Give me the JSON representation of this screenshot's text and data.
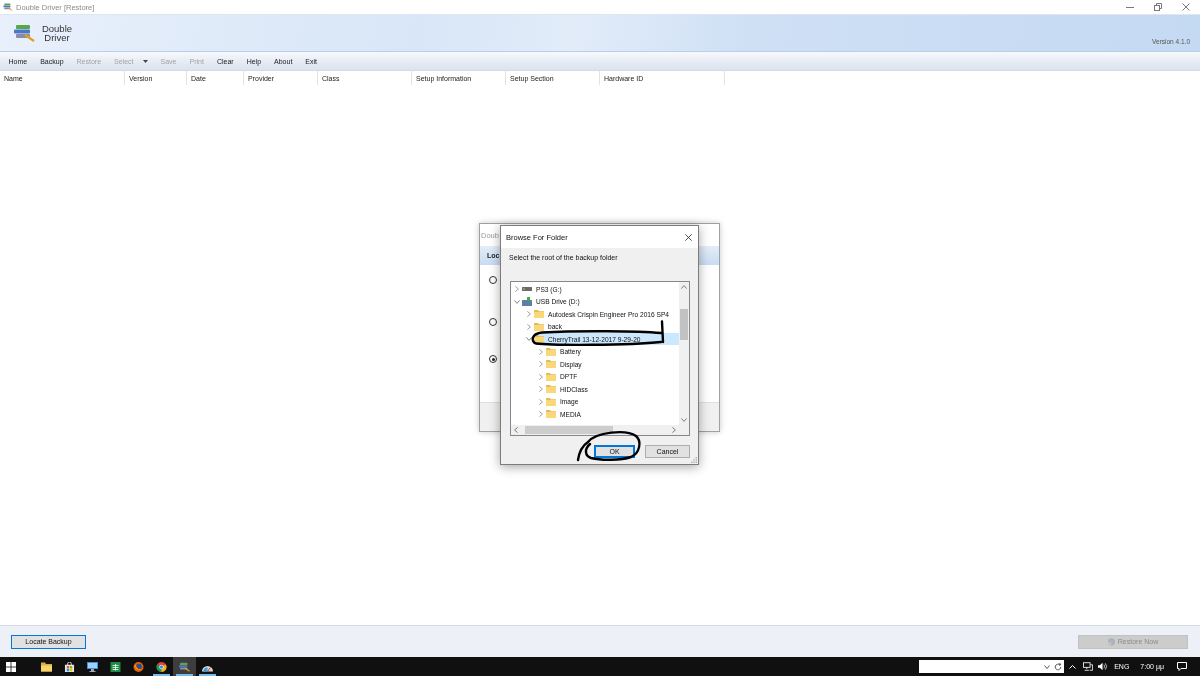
{
  "window": {
    "title": "Double Driver [Restore]"
  },
  "header": {
    "app_name": "Double Driver",
    "version": "Version 4.1.0"
  },
  "toolbar": [
    {
      "label": "Home",
      "disabled": false,
      "menu": false
    },
    {
      "label": "Backup",
      "disabled": false,
      "menu": false
    },
    {
      "label": "Restore",
      "disabled": true,
      "menu": false
    },
    {
      "label": "Select",
      "disabled": true,
      "menu": true
    },
    {
      "label": "Save",
      "disabled": true,
      "menu": false
    },
    {
      "label": "Print",
      "disabled": true,
      "menu": false
    },
    {
      "label": "Clear",
      "disabled": false,
      "menu": false
    },
    {
      "label": "Help",
      "disabled": false,
      "menu": false
    },
    {
      "label": "About",
      "disabled": false,
      "menu": false
    },
    {
      "label": "Exit",
      "disabled": false,
      "menu": false
    }
  ],
  "table": {
    "columns": [
      "Name",
      "Version",
      "Date",
      "Provider",
      "Class",
      "Setup Information",
      "Setup Section",
      "Hardware ID"
    ]
  },
  "back_dialog": {
    "title": "Doub",
    "heading": "Loc",
    "options": [
      {
        "selected": false
      },
      {
        "selected": false
      },
      {
        "selected": true
      }
    ]
  },
  "browse_dialog": {
    "title": "Browse For Folder",
    "prompt": "Select the root of the backup folder",
    "tree": [
      {
        "label": "PS3 (G:)",
        "kind": "drive",
        "expanded": false,
        "selected": false
      },
      {
        "label": "USB Drive (D:)",
        "kind": "usb-drive",
        "expanded": true,
        "selected": false,
        "children": [
          {
            "label": "Autodesk Crispin Engineer Pro 2016 SP4",
            "kind": "folder",
            "expanded": false,
            "selected": false
          },
          {
            "label": "back",
            "kind": "folder",
            "expanded": false,
            "selected": false
          },
          {
            "label": "CherryTrail 13-12-2017 9-29-20",
            "kind": "folder",
            "expanded": true,
            "selected": true,
            "children": [
              {
                "label": "Battery",
                "kind": "folder",
                "expanded": false,
                "selected": false
              },
              {
                "label": "Display",
                "kind": "folder",
                "expanded": false,
                "selected": false
              },
              {
                "label": "DPTF",
                "kind": "folder",
                "expanded": false,
                "selected": false
              },
              {
                "label": "HIDClass",
                "kind": "folder",
                "expanded": false,
                "selected": false
              },
              {
                "label": "Image",
                "kind": "folder",
                "expanded": false,
                "selected": false
              },
              {
                "label": "MEDIA",
                "kind": "folder",
                "expanded": false,
                "selected": false
              }
            ]
          }
        ]
      }
    ],
    "buttons": [
      {
        "label": "OK",
        "focused": true
      },
      {
        "label": "Cancel",
        "focused": false
      }
    ]
  },
  "ink_marks": [
    {
      "kind": "ellipse"
    },
    {
      "kind": "circle"
    }
  ],
  "footer": {
    "locate_button": {
      "label": "Locate Backup",
      "disabled": false,
      "focused": true
    },
    "restore_button": {
      "label": "Restore Now",
      "disabled": true,
      "focused": false
    }
  },
  "taskbar": {
    "apps": [
      {
        "kind": "folder",
        "running": false,
        "selected": false
      },
      {
        "kind": "bag",
        "running": false,
        "selected": false
      },
      {
        "kind": "monitor",
        "running": false,
        "selected": false
      },
      {
        "kind": "tile",
        "running": false,
        "selected": false
      },
      {
        "kind": "globe",
        "running": false,
        "selected": false
      },
      {
        "kind": "wheel",
        "running": true,
        "selected": false
      },
      {
        "kind": "stack",
        "running": true,
        "selected": true
      },
      {
        "kind": "gauge",
        "running": true,
        "selected": false
      }
    ],
    "language": "ENG",
    "time": "7:00 μμ"
  }
}
